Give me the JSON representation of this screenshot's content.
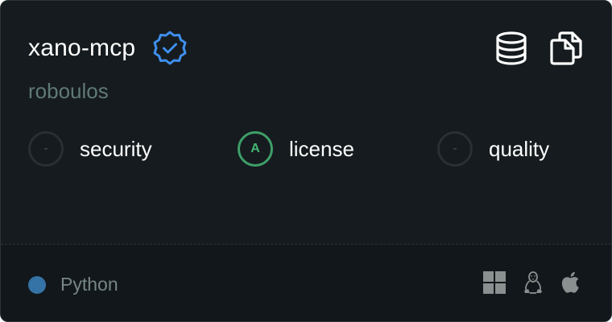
{
  "server": {
    "name": "xano-mcp",
    "author": "roboulos",
    "verified": true
  },
  "actions": {
    "database_icon": "database-icon",
    "copy_icon": "copy-icon"
  },
  "scores": [
    {
      "grade": "-",
      "label": "security",
      "status": "none"
    },
    {
      "grade": "A",
      "label": "license",
      "status": "good"
    },
    {
      "grade": "-",
      "label": "quality",
      "status": "none"
    }
  ],
  "language": {
    "name": "Python",
    "color": "#3572a5"
  },
  "platforms": [
    "windows-icon",
    "linux-icon",
    "apple-icon"
  ],
  "colors": {
    "verified": "#3f8ff0",
    "grade_good": "#44b674",
    "muted_text": "#607978"
  }
}
